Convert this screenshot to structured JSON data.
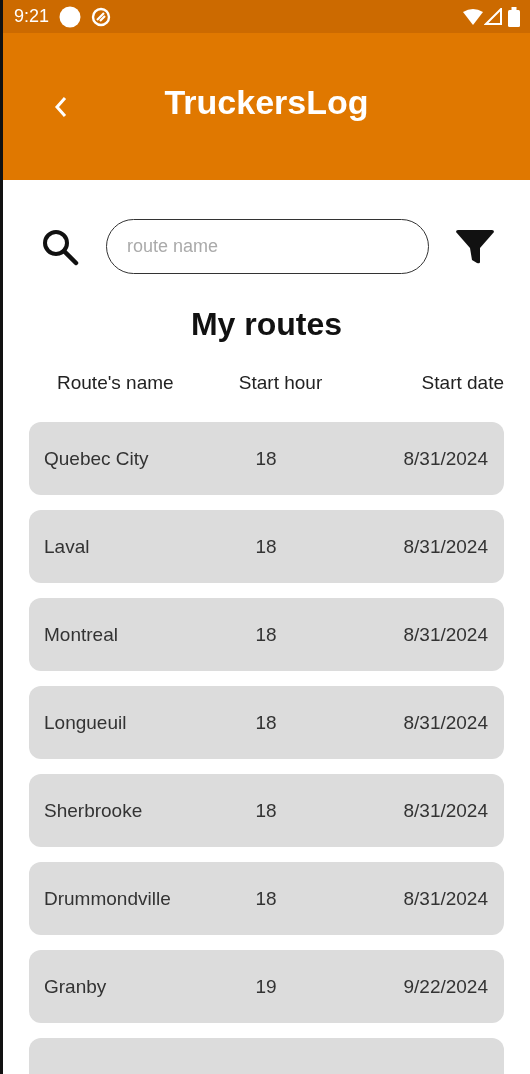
{
  "status_bar": {
    "time": "9:21"
  },
  "app_bar": {
    "title": "TruckersLog"
  },
  "search": {
    "placeholder": "route name"
  },
  "heading": "My routes",
  "table": {
    "columns": [
      "Route's name",
      "Start hour",
      "Start date"
    ],
    "rows": [
      {
        "name": "Quebec City",
        "hour": "18",
        "date": "8/31/2024"
      },
      {
        "name": "Laval",
        "hour": "18",
        "date": "8/31/2024"
      },
      {
        "name": "Montreal",
        "hour": "18",
        "date": "8/31/2024"
      },
      {
        "name": "Longueuil",
        "hour": "18",
        "date": "8/31/2024"
      },
      {
        "name": "Sherbrooke",
        "hour": "18",
        "date": "8/31/2024"
      },
      {
        "name": "Drummondville",
        "hour": "18",
        "date": "8/31/2024"
      },
      {
        "name": "Granby",
        "hour": "19",
        "date": "9/22/2024"
      }
    ]
  }
}
